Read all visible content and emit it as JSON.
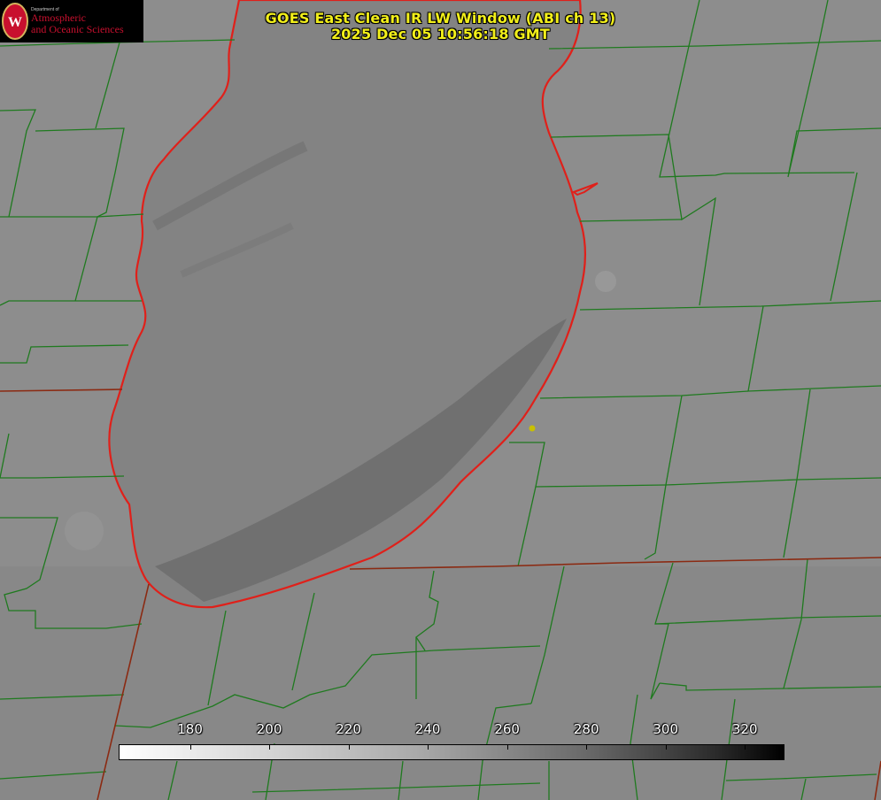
{
  "title": {
    "line1": "GOES East Clean IR LW Window (ABI ch 13)",
    "line2": "2025 Dec 05 10:56:18 GMT"
  },
  "logo": {
    "department": "Department of",
    "name_line1": "Atmospheric",
    "name_line2": "and Oceanic Sciences",
    "seal_letter": "W"
  },
  "colorbar": {
    "ticks": [
      "180",
      "200",
      "220",
      "240",
      "260",
      "280",
      "300",
      "320"
    ],
    "tick_values": [
      180,
      200,
      220,
      240,
      260,
      280,
      300,
      320
    ],
    "range": [
      162,
      330
    ],
    "colormap": "white-to-black grayscale"
  },
  "colors": {
    "county_lines": "#1f7a1f",
    "coastline": "#e0201a",
    "state_lines": "#8b2a12",
    "title_text": "#f2ef1a",
    "station_marker": "#c8c000"
  }
}
